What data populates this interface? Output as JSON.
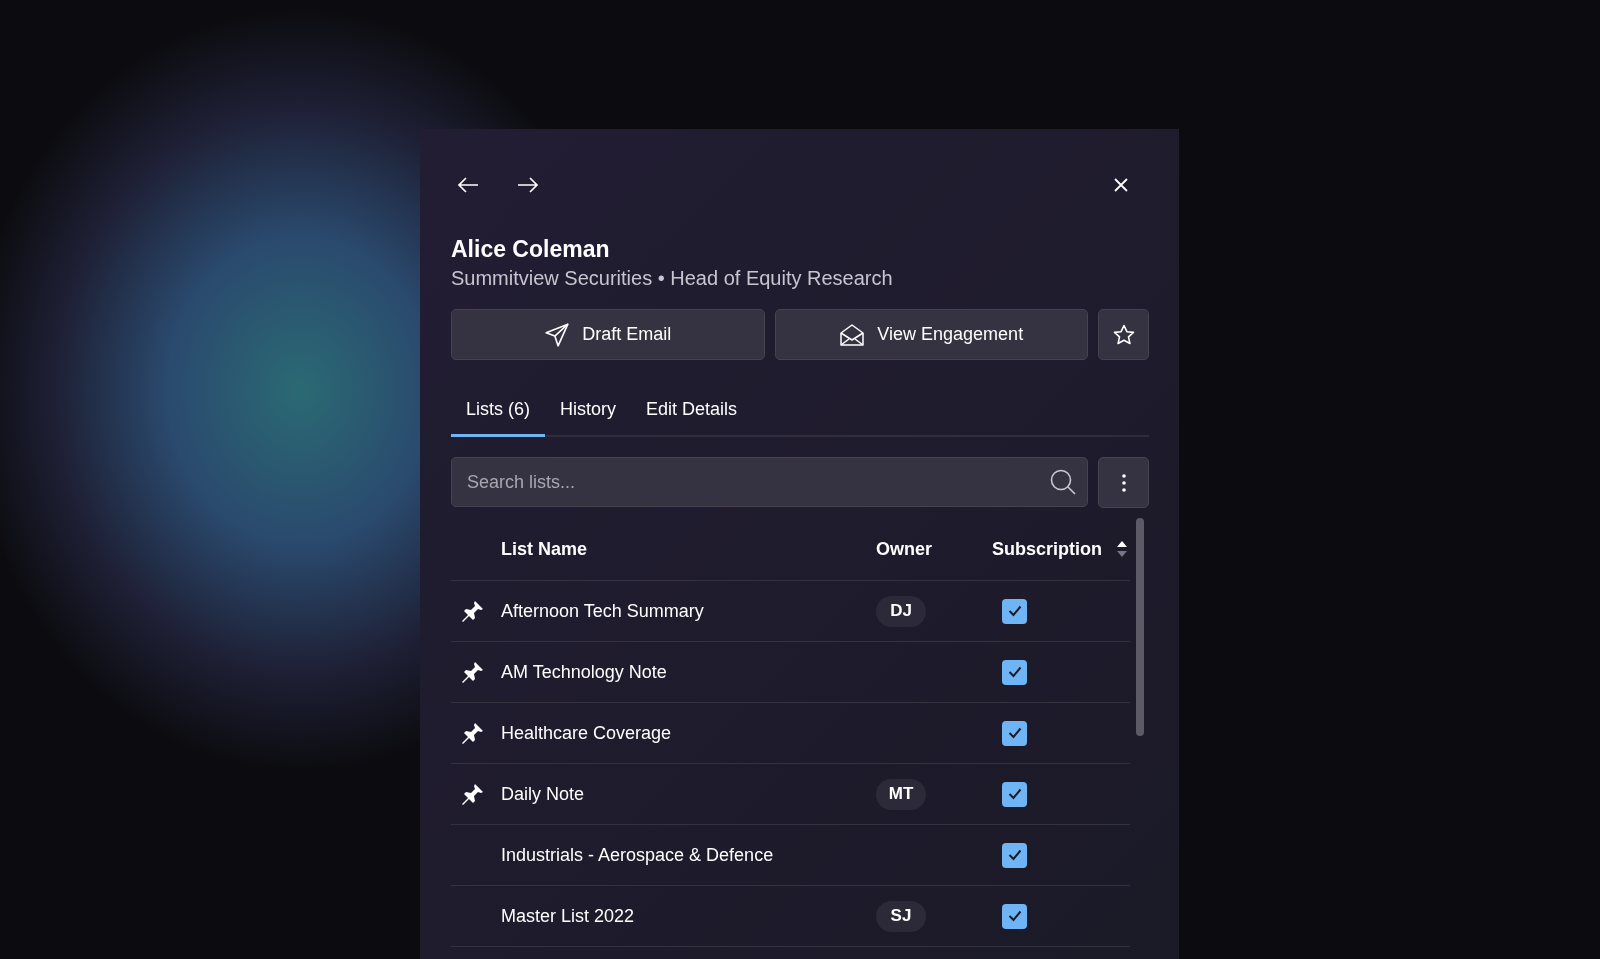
{
  "contact": {
    "name": "Alice Coleman",
    "subtitle": "Summitview Securities • Head of Equity Research"
  },
  "actions": [
    {
      "kind": "send",
      "label": "Draft Email"
    },
    {
      "kind": "envelope",
      "label": "View Engagement"
    },
    {
      "kind": "star"
    }
  ],
  "tabs": [
    {
      "label": "Lists (6)",
      "selected": true
    },
    {
      "label": "History",
      "selected": false
    },
    {
      "label": "Edit Details",
      "selected": false
    }
  ],
  "search": {
    "placeholder": "Search lists..."
  },
  "table": {
    "columns": [
      {
        "label": "List Name"
      },
      {
        "label": "Owner"
      },
      {
        "label": "Subscription"
      }
    ],
    "rows": [
      {
        "pinned": true,
        "name": "Afternoon Tech Summary",
        "owner": "DJ",
        "subscribed": true
      },
      {
        "pinned": true,
        "name": "AM Technology Note",
        "subscribed": true
      },
      {
        "pinned": true,
        "name": "Healthcare Coverage",
        "subscribed": true
      },
      {
        "pinned": true,
        "name": "Daily Note",
        "owner": "MT",
        "subscribed": true
      },
      {
        "pinned": false,
        "name": "Industrials - Aerospace & Defence",
        "subscribed": true
      },
      {
        "pinned": false,
        "name": "Master List 2022",
        "owner": "SJ",
        "subscribed": true
      }
    ]
  }
}
